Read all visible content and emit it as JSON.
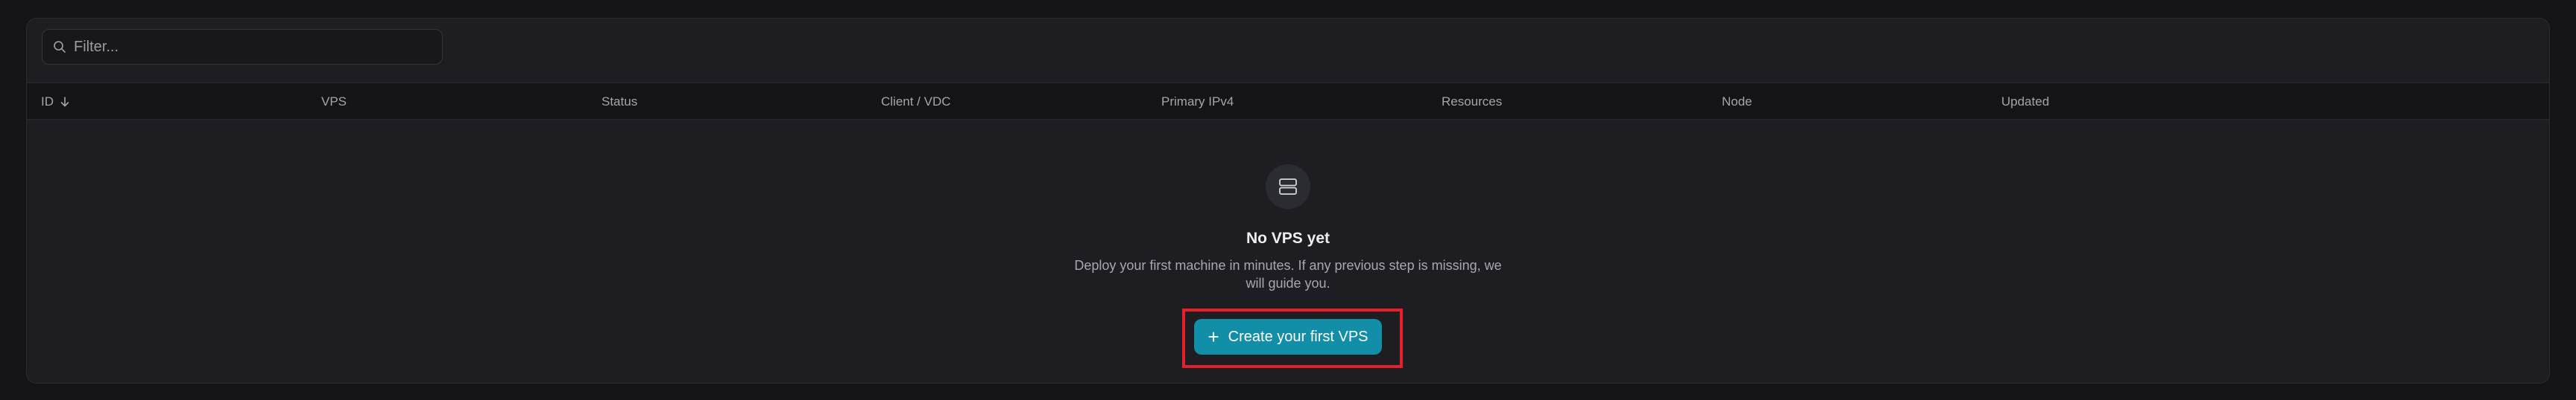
{
  "filter": {
    "placeholder": "Filter...",
    "icon": "search-icon"
  },
  "table": {
    "columns": [
      {
        "label": "ID",
        "sort": "desc"
      },
      {
        "label": "VPS"
      },
      {
        "label": "Status"
      },
      {
        "label": "Client / VDC"
      },
      {
        "label": "Primary IPv4"
      },
      {
        "label": "Resources"
      },
      {
        "label": "Node"
      },
      {
        "label": "Updated"
      }
    ]
  },
  "empty_state": {
    "icon": "server-icon",
    "title": "No VPS yet",
    "description": "Deploy your first machine in minutes. If any previous step is missing, we will guide you.",
    "button_icon": "+",
    "button_label": "Create your first VPS"
  },
  "colors": {
    "accent": "#138ea8",
    "highlight": "#e5202a",
    "background": "#141416",
    "panel": "#1e1e22"
  }
}
